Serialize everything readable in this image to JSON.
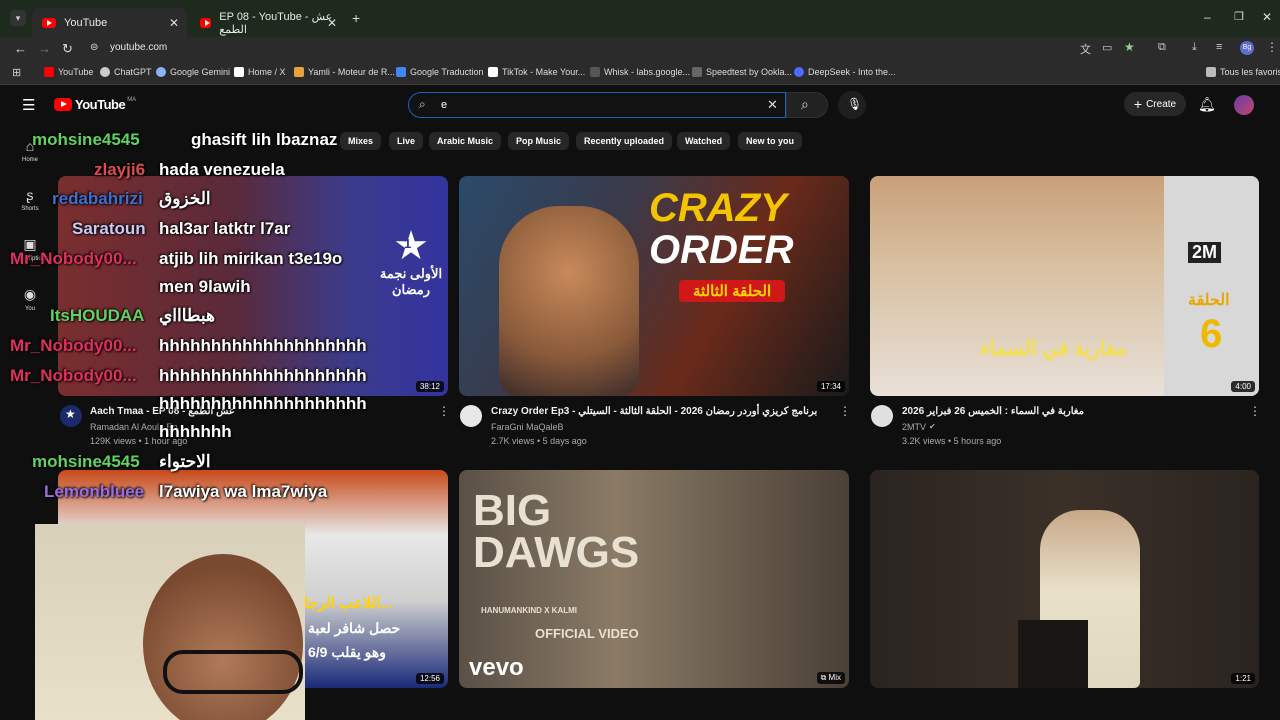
{
  "browser": {
    "tabs": [
      {
        "title": "YouTube",
        "active": true
      },
      {
        "title": "EP 08 - YouTube - عش الطمع",
        "active": false
      }
    ],
    "url": "youtube.com",
    "bookmarks": [
      {
        "label": "YouTube",
        "color": "#ff0000"
      },
      {
        "label": "ChatGPT",
        "color": "#cccccc"
      },
      {
        "label": "Google Gemini",
        "color": "#8ab4f8"
      },
      {
        "label": "Home / X",
        "color": "#ffffff"
      },
      {
        "label": "Yamli - Moteur de R...",
        "color": "#e8a33d"
      },
      {
        "label": "Google Traduction",
        "color": "#4285f4"
      },
      {
        "label": "TikTok - Make Your...",
        "color": "#ffffff"
      },
      {
        "label": "Whisk - labs.google...",
        "color": "#555555"
      },
      {
        "label": "Speedtest by Ookla...",
        "color": "#666666"
      },
      {
        "label": "DeepSeek - Into the...",
        "color": "#4d6bfe"
      }
    ],
    "all_bookmarks": "Tous les favoris"
  },
  "youtube": {
    "logo": "YouTube",
    "region": "MA",
    "search_value": "e",
    "create_label": "Create",
    "sidebar": [
      {
        "icon": "home-icon",
        "label": "Home"
      },
      {
        "icon": "shorts-icon",
        "label": "Shorts"
      },
      {
        "icon": "subscriptions-icon",
        "label": "Subscriptions"
      },
      {
        "icon": "you-icon",
        "label": "You"
      }
    ],
    "chips": [
      "Mixes",
      "Live",
      "Arabic Music",
      "Pop Music",
      "Recently uploaded",
      "Watched",
      "New to you"
    ],
    "videos": [
      {
        "title": "Aach Tmaa - EP 08 - عش الطمع",
        "channel": "Ramadan Al Aoula Ep",
        "meta": "129K views • 1 hour ago",
        "duration": "38:12"
      },
      {
        "title": "Crazy Order Ep3 - برنامج كريزي أوردر رمضان 2026 - الحلقة الثالثة - السيتلي",
        "channel": "FaraGni MaQaleB",
        "meta": "2.7K views • 5 days ago",
        "duration": "17:34"
      },
      {
        "title": "مغاربة في السماء : الخميس 26 فبراير 2026",
        "channel": "2MTV",
        "meta": "3.2K views • 5 hours ago",
        "duration": "4:00"
      },
      {
        "title": "",
        "channel": "",
        "meta": "",
        "duration": "12:56"
      },
      {
        "title": "",
        "channel": "",
        "meta": "",
        "duration": "Mix"
      },
      {
        "title": "",
        "channel": "",
        "meta": "",
        "duration": "1:21"
      }
    ],
    "thumb_text": {
      "crazy": "CRAZY",
      "order": "ORDER",
      "ep_ar": "الحلقة الثالثة",
      "tv_num": "1",
      "tv_ar": "الأولى نجمة رمضان",
      "m2": "2M",
      "ep_ar2": "الحلقة",
      "ep_num": "6",
      "sama_ar": "مغاربة في السماء",
      "big": "BIG DAWGS",
      "artist": "HANUMANKIND X KALMI",
      "official": "OFFICIAL VIDEO",
      "vevo": "vevo",
      "player_ar": "اللاعب الرجا...",
      "player_ar2": "حصل شافر لعبة",
      "player_ar3": "وهو يقلب 6/9"
    }
  },
  "chat": [
    {
      "user": "mohsine4545",
      "color": "#5fd35f",
      "msg": "ghasift lih lbaznaz"
    },
    {
      "user": "zlayji6",
      "color": "#e04b4b",
      "msg": "hada venezuela"
    },
    {
      "user": "redabahrizi",
      "color": "#3b6fd1",
      "msg": "الخزوق"
    },
    {
      "user": "Saratoun",
      "color": "#c9c9f5",
      "msg": "hal3ar latktr l7ar"
    },
    {
      "user": "",
      "color": "#ffffff",
      "msg": "atjib lih mirikan t3e19o"
    },
    {
      "user": "Mr_Nobody00...",
      "color": "#e0305e",
      "msg": "men 9lawih"
    },
    {
      "user": "ItsHOUDAA",
      "color": "#5fd35f",
      "msg": "هبطاااي"
    },
    {
      "user": "Mr_Nobody00...",
      "color": "#e0305e",
      "msg": "hhhhhhhhhhhhhhhhhhhh"
    },
    {
      "user": "Mr_Nobody00...",
      "color": "#e0305e",
      "msg": "hhhhhhhhhhhhhhhhhhhh"
    },
    {
      "user": "",
      "color": "#ffffff",
      "msg": "hhhhhhhhhhhhhhhhhhhh"
    },
    {
      "user": "",
      "color": "#ffffff",
      "msg": "hhhhhhh"
    },
    {
      "user": "mohsine4545",
      "color": "#5fd35f",
      "msg": "الاحتواء"
    },
    {
      "user": "Lemonbluee",
      "color": "#9a6ee0",
      "msg": "l7awiya wa lma7wiya"
    }
  ]
}
